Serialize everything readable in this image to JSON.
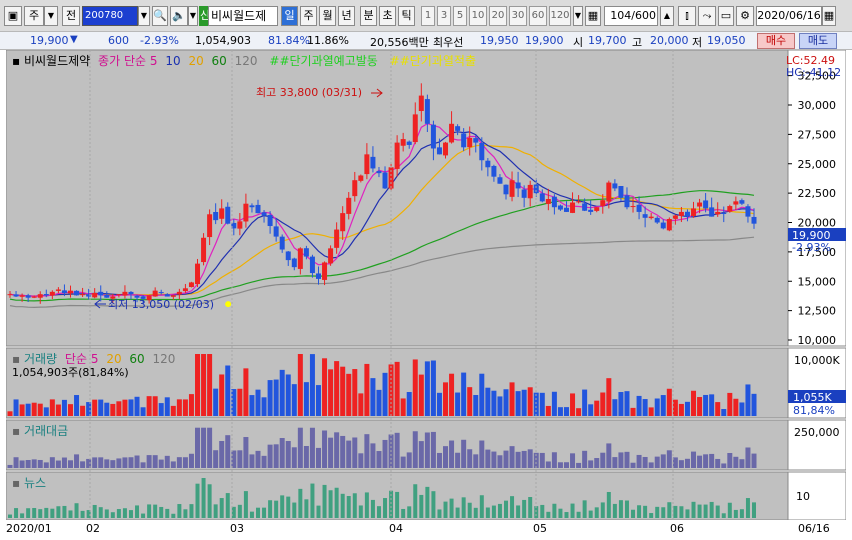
{
  "toolbar": {
    "market_label": "주",
    "prefix_label": "전",
    "stock_code": "200780",
    "stock_name": "비씨월드제",
    "period_tabs": [
      "일",
      "주",
      "월",
      "년",
      "분",
      "초",
      "틱"
    ],
    "active_period": "일",
    "interval_values": [
      "1",
      "3",
      "5",
      "10",
      "20",
      "30",
      "60",
      "120"
    ],
    "bar_count": "104",
    "bar_total": "/600",
    "date_value": "2020/06/16",
    "new_badge": "신"
  },
  "quote": {
    "price": "19,900",
    "change_arrow": "▼",
    "change": "600",
    "change_pct": "-2.93%",
    "volume": "1,054,903",
    "vol_ratio": "81.84%",
    "turnover": "11.86%",
    "amount": "20,556백만",
    "best_ask_label": "최우선",
    "best_ask": "19,950",
    "best_bid": "19,900",
    "open_label": "시",
    "open": "19,700",
    "high_label": "고",
    "high": "20,000",
    "low_label": "저",
    "low": "19,050",
    "buy_label": "매수",
    "sell_label": "매도"
  },
  "price_panel": {
    "stock_title": "비씨월드제약",
    "ma_label": "종가 단순",
    "ma_periods": [
      "5",
      "10",
      "20",
      "60",
      "120"
    ],
    "signal_1": "##단기과열예고발동",
    "signal_2": "##단기과열적출",
    "lc_label": "LC:52.49",
    "hc_label": "HC:-41.12",
    "y_ticks": [
      "32,500",
      "30,000",
      "27,500",
      "25,000",
      "22,500",
      "20,000",
      "17,500",
      "15,000",
      "12,500",
      "10,000"
    ],
    "current_price_label": "19,900",
    "current_pct_label": "-2.93%",
    "max_annotation": "최고 33,800 (03/31)",
    "min_annotation": "최저 13,050 (02/03)"
  },
  "volume_panel": {
    "title": "거래량",
    "ma_label": "단순",
    "ma_periods": [
      "5",
      "20",
      "60",
      "120"
    ],
    "volume_text": "1,054,903주(81,84%)",
    "y_tick": "10,000K",
    "current_label": "1,055K",
    "current_pct": "81,84%"
  },
  "amount_panel": {
    "title": "거래대금",
    "y_tick": "250,000"
  },
  "news_panel": {
    "title": "뉴스",
    "y_tick": "10"
  },
  "x_axis": {
    "labels": [
      "2020/01",
      "02",
      "03",
      "04",
      "05",
      "06"
    ],
    "right_label": "06/16"
  },
  "colors": {
    "up": "#ee2222",
    "down": "#2255dd",
    "ma5": "#e020c0",
    "ma10": "#2030b0",
    "ma20": "#f0b000",
    "ma60": "#20a020",
    "ma120": "#888888",
    "panel_bg": "#c0c0c0"
  },
  "chart_data": {
    "type": "candlestick",
    "note_x": "daily bars from 2020/01 to 2020/06/16",
    "closes": [
      13900,
      13700,
      13800,
      13600,
      13700,
      13900,
      13800,
      14100,
      14300,
      14000,
      14200,
      13800,
      13900,
      13700,
      14000,
      13800,
      13600,
      13700,
      13900,
      14100,
      13900,
      13600,
      13500,
      13800,
      14200,
      14000,
      13700,
      13800,
      14100,
      14400,
      14900,
      16500,
      18700,
      20700,
      20200,
      21200,
      19900,
      19500,
      20100,
      21600,
      21300,
      20800,
      20600,
      19700,
      18800,
      17700,
      16800,
      16200,
      17800,
      17100,
      15700,
      15200,
      16600,
      17800,
      19400,
      20800,
      22100,
      23600,
      24000,
      25800,
      24600,
      24200,
      22900,
      24700,
      26800,
      27100,
      26600,
      29200,
      30800,
      28400,
      26300,
      25800,
      26800,
      28400,
      27800,
      26400,
      27200,
      26800,
      25300,
      24700,
      23900,
      23300,
      22400,
      23600,
      22900,
      22100,
      23200,
      22500,
      21800,
      22000,
      21300,
      21100,
      20900,
      21700,
      21800,
      21000,
      20900,
      21300,
      21900,
      23400,
      22900,
      22100,
      21300,
      21400,
      20900,
      20400,
      20500,
      20000,
      19500,
      20300,
      20600,
      20900,
      20500,
      21200,
      21700,
      21200,
      20500,
      20900,
      20800,
      21400,
      21800,
      21600,
      20500,
      19900
    ],
    "max_close": 33800,
    "min_close": 13050,
    "y_range": [
      10000,
      32500
    ]
  }
}
